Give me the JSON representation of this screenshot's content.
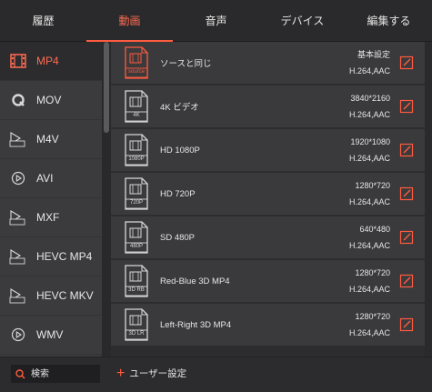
{
  "tabs": [
    {
      "label": "履歴",
      "active": false
    },
    {
      "label": "動画",
      "active": true
    },
    {
      "label": "音声",
      "active": false
    },
    {
      "label": "デバイス",
      "active": false
    },
    {
      "label": "編集する",
      "active": false
    }
  ],
  "formats": [
    {
      "label": "MP4",
      "icon": "film-icon",
      "active": true
    },
    {
      "label": "MOV",
      "icon": "quicktime-icon",
      "active": false
    },
    {
      "label": "M4V",
      "icon": "m4v-icon",
      "active": false
    },
    {
      "label": "AVI",
      "icon": "play-circle-icon",
      "active": false
    },
    {
      "label": "MXF",
      "icon": "mxf-icon",
      "active": false
    },
    {
      "label": "HEVC MP4",
      "icon": "hevc-icon",
      "active": false
    },
    {
      "label": "HEVC MKV",
      "icon": "hevc-icon",
      "active": false
    },
    {
      "label": "WMV",
      "icon": "play-circle-icon",
      "active": false
    }
  ],
  "presets": [
    {
      "name": "ソースと同じ",
      "badge": "source",
      "res": "基本設定",
      "codec": "H.264,AAC",
      "highlight": true
    },
    {
      "name": "4K ビデオ",
      "badge": "4K",
      "res": "3840*2160",
      "codec": "H.264,AAC",
      "highlight": false
    },
    {
      "name": "HD 1080P",
      "badge": "1080P",
      "res": "1920*1080",
      "codec": "H.264,AAC",
      "highlight": false
    },
    {
      "name": "HD 720P",
      "badge": "720P",
      "res": "1280*720",
      "codec": "H.264,AAC",
      "highlight": false
    },
    {
      "name": "SD 480P",
      "badge": "480P",
      "res": "640*480",
      "codec": "H.264,AAC",
      "highlight": false
    },
    {
      "name": "Red-Blue 3D MP4",
      "badge": "3D RB",
      "res": "1280*720",
      "codec": "H.264,AAC",
      "highlight": false
    },
    {
      "name": "Left-Right 3D MP4",
      "badge": "3D LR",
      "res": "1280*720",
      "codec": "H.264,AAC",
      "highlight": false
    }
  ],
  "search": {
    "placeholder": "検索"
  },
  "custom_label": "ユーザー設定",
  "colors": {
    "accent": "#ff5b40",
    "bg": "#2d2d2f",
    "panel": "#3a3a3c"
  }
}
